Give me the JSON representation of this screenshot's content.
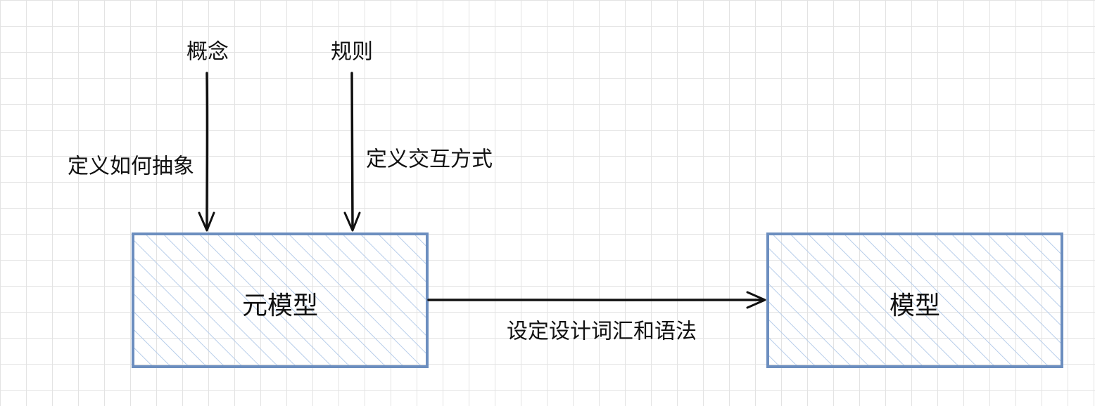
{
  "nodes": {
    "metamodel": {
      "label": "元模型"
    },
    "model": {
      "label": "模型"
    }
  },
  "inputs": {
    "concept": {
      "label": "概念",
      "annotation": "定义如何抽象"
    },
    "rule": {
      "label": "规则",
      "annotation": "定义交互方式"
    }
  },
  "edge": {
    "label": "设定设计词汇和语法"
  },
  "colors": {
    "box_stroke": "#6c8ebf",
    "hatch": "#b7cdea",
    "arrow": "#111111",
    "grid": "#e3e3e3"
  }
}
